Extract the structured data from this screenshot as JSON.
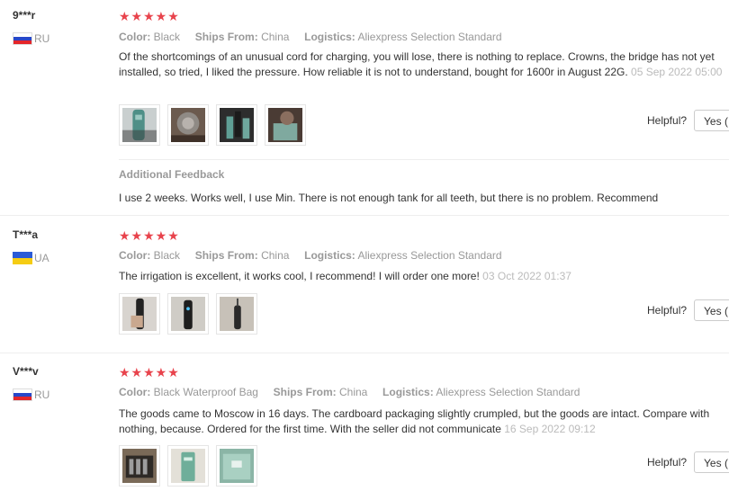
{
  "reviews": [
    {
      "user": "9***r",
      "country": "RU",
      "rating": "★★★★★",
      "color_label": "Color:",
      "color_value": "Black",
      "ships_label": "Ships From:",
      "ships_value": "China",
      "logistics_label": "Logistics:",
      "logistics_value": "Aliexpress Selection Standard",
      "text": "Of the shortcomings of an unusual cord for charging, you will lose, there is nothing to replace. Crowns, the bridge has not yet installed, so tried, I liked the pressure. How reliable it is not to understand, bought for 1600r in August 22G.",
      "date": "05 Sep 2022 05:00",
      "photos": [
        "photo-1",
        "photo-2",
        "photo-3",
        "photo-4"
      ],
      "helpful_label": "Helpful?",
      "yes_label": "Yes (",
      "additional_feedback_title": "Additional Feedback",
      "additional_feedback_text": "I use 2 weeks. Works well, I use Min. There is not enough tank for all teeth, but there is no problem. Recommend"
    },
    {
      "user": "T***a",
      "country": "UA",
      "rating": "★★★★★",
      "color_label": "Color:",
      "color_value": "Black",
      "ships_label": "Ships From:",
      "ships_value": "China",
      "logistics_label": "Logistics:",
      "logistics_value": "Aliexpress Selection Standard",
      "text": "The irrigation is excellent, it works cool, I recommend! I will order one more!",
      "date": "03 Oct 2022 01:37",
      "photos": [
        "photo-1",
        "photo-2",
        "photo-3"
      ],
      "helpful_label": "Helpful?",
      "yes_label": "Yes ("
    },
    {
      "user": "V***v",
      "country": "RU",
      "rating": "★★★★★",
      "color_label": "Color:",
      "color_value": "Black Waterproof Bag",
      "ships_label": "Ships From:",
      "ships_value": "China",
      "logistics_label": "Logistics:",
      "logistics_value": "Aliexpress Selection Standard",
      "text": "The goods came to Moscow in 16 days. The cardboard packaging slightly crumpled, but the goods are intact. Compare with nothing, because. Ordered for the first time. With the seller did not communicate",
      "date": "16 Sep 2022 09:12",
      "photos": [
        "photo-1",
        "photo-2",
        "photo-3"
      ],
      "helpful_label": "Helpful?",
      "yes_label": "Yes ("
    }
  ],
  "colors": {
    "star": "#e8434c",
    "muted": "#999999",
    "text": "#333333"
  }
}
